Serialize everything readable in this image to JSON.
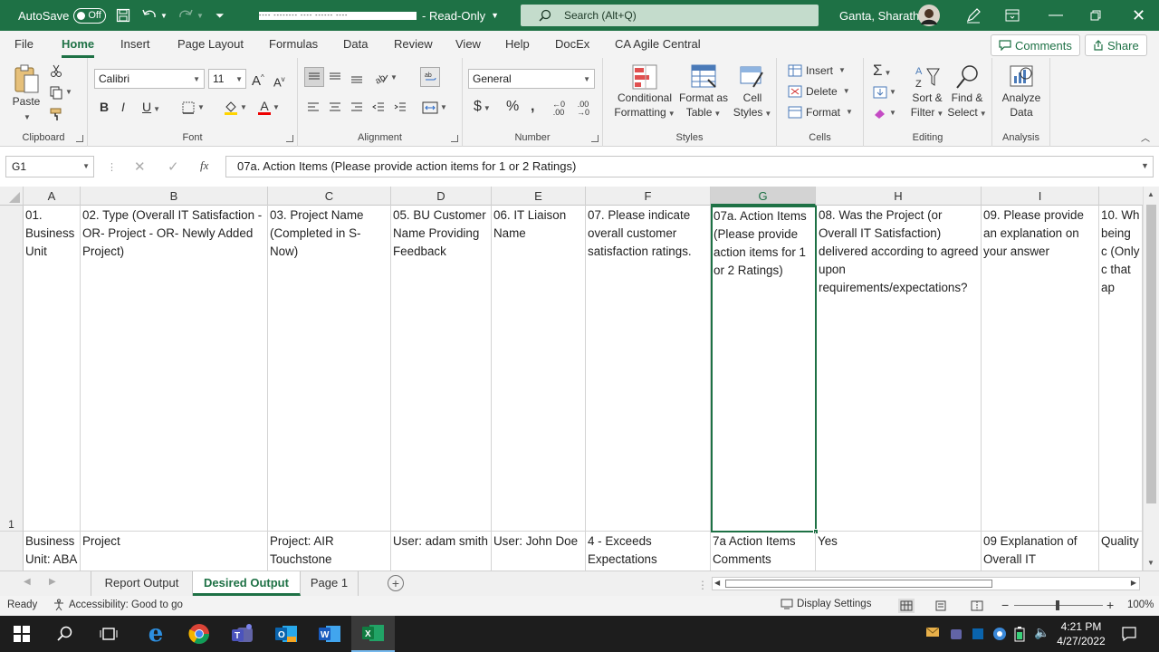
{
  "titlebar": {
    "autosave": "AutoSave",
    "toggle": "Off",
    "filename_redacted": "---- -------- ---- ------ ----",
    "mode": "- Read-Only",
    "search_placeholder": "Search (Alt+Q)",
    "user": "Ganta, Sharath"
  },
  "tabs": [
    "File",
    "Home",
    "Insert",
    "Page Layout",
    "Formulas",
    "Data",
    "Review",
    "View",
    "Help",
    "DocEx",
    "CA Agile Central"
  ],
  "comments": "Comments",
  "share": "Share",
  "ribbon": {
    "clipboard": {
      "label": "Clipboard",
      "paste": "Paste"
    },
    "font": {
      "label": "Font",
      "name": "Calibri",
      "size": "11"
    },
    "alignment": {
      "label": "Alignment"
    },
    "number": {
      "label": "Number",
      "format": "General"
    },
    "styles": {
      "label": "Styles",
      "cond1": "Conditional",
      "cond2": "Formatting",
      "fmt1": "Format as",
      "fmt2": "Table",
      "cell1": "Cell",
      "cell2": "Styles"
    },
    "cells": {
      "label": "Cells",
      "insert": "Insert",
      "delete": "Delete",
      "format": "Format"
    },
    "editing": {
      "label": "Editing",
      "sort1": "Sort &",
      "sort2": "Filter",
      "find1": "Find &",
      "find2": "Select"
    },
    "analysis": {
      "label": "Analysis",
      "a1": "Analyze",
      "a2": "Data"
    }
  },
  "formula": {
    "namebox": "G1",
    "fx": "fx",
    "content": "07a. Action Items (Please provide action items for 1 or 2 Ratings)"
  },
  "columns": [
    "A",
    "B",
    "C",
    "D",
    "E",
    "F",
    "G",
    "H",
    "I",
    ""
  ],
  "rows": [
    "1",
    ""
  ],
  "row1": [
    "01. Business Unit",
    "02. Type (Overall IT Satisfaction - OR- Project - OR- Newly Added Project)",
    "03. Project Name (Completed in S-Now)",
    "05. BU Customer Name Providing Feedback",
    "06. IT Liaison Name",
    "07. Please indicate overall customer satisfaction ratings.",
    "07a. Action Items (Please provide action items for 1 or 2 Ratings)",
    "08. Was the Project (or Overall IT Satisfaction) delivered according to agreed upon requirements/expectations?",
    "09. Please provide an explanation on your answer",
    "10. Wh being c (Only c that ap"
  ],
  "row2": [
    "Business Unit: ABA",
    "Project",
    "Project: AIR Touchstone",
    "User: adam smith",
    "User: John Doe",
    "4 - Exceeds Expectations",
    "7a Action Items Comments",
    "Yes",
    "09 Explanation of Overall IT",
    "Quality"
  ],
  "sheets": [
    "Report Output",
    "Desired Output",
    "Page 1"
  ],
  "status": {
    "ready": "Ready",
    "accessibility": "Accessibility: Good to go",
    "display": "Display Settings",
    "zoom": "100%"
  },
  "clock": {
    "time": "4:21 PM",
    "date": "4/27/2022"
  },
  "colors": {
    "accent": "#1e7145",
    "selection": "#1e7145"
  }
}
